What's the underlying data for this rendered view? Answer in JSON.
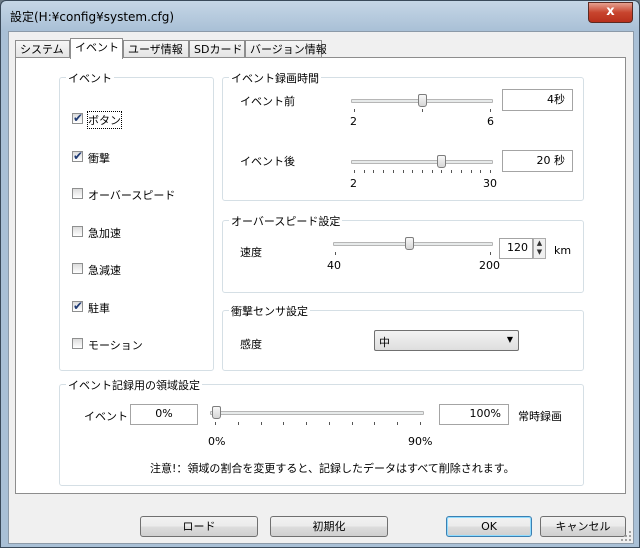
{
  "window": {
    "title": "設定(H:¥config¥system.cfg)",
    "close_glyph": "x"
  },
  "tabs": [
    {
      "label": "システム"
    },
    {
      "label": "イベント"
    },
    {
      "label": "ユーザ情報"
    },
    {
      "label": "SDカード"
    },
    {
      "label": "バージョン情報"
    }
  ],
  "event_group": {
    "title": "イベント",
    "items": [
      {
        "label": "ボタン",
        "checked": true
      },
      {
        "label": "衝撃",
        "checked": true
      },
      {
        "label": "オーバースピード",
        "checked": false
      },
      {
        "label": "急加速",
        "checked": false
      },
      {
        "label": "急減速",
        "checked": false
      },
      {
        "label": "駐車",
        "checked": true
      },
      {
        "label": "モーション",
        "checked": false
      }
    ]
  },
  "record_time": {
    "title": "イベント録画時間",
    "before": {
      "label": "イベント前",
      "min": "2",
      "max": "6",
      "value": "4秒"
    },
    "after": {
      "label": "イベント後",
      "min": "2",
      "max": "30",
      "value": "20 秒"
    }
  },
  "overspeed": {
    "title": "オーバースピード設定",
    "label": "速度",
    "min": "40",
    "max": "200",
    "value": "120",
    "unit": "km"
  },
  "shock": {
    "title": "衝撃センサ設定",
    "label": "感度",
    "value": "中"
  },
  "area": {
    "title": "イベント記録用の領域設定",
    "label": "イベント",
    "event_value": "0%",
    "min": "0%",
    "max": "90%",
    "always_value": "100%",
    "always_label": "常時録画",
    "note": "注意!：領域の割合を変更すると、記録したデータはすべて削除されます。"
  },
  "buttons": {
    "load": "ロード",
    "init": "初期化",
    "ok": "OK",
    "cancel": "キャンセル"
  },
  "check_glyph": "✔",
  "spin_up": "▲",
  "spin_down": "▼",
  "dropdown_glyph": "▼"
}
